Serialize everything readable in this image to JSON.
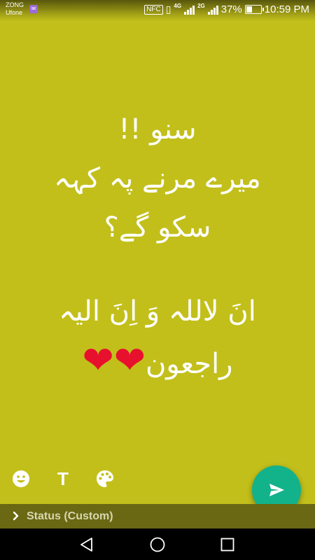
{
  "status_bar": {
    "carrier_1": "ZONG",
    "carrier_2": "Ufone",
    "nfc_label": "NFC",
    "network_1": "4G",
    "network_2": "2G",
    "battery_percent_text": "37%",
    "battery_level": 0.37,
    "time": "10:59 PM"
  },
  "status": {
    "line_1": "سنو !!",
    "line_2": "میرے مرنے پہ کہہ",
    "line_3": "سکو گے؟",
    "line_4": "انَ لاللہ وَ اِنَ الیہ",
    "line_5": "راجعون",
    "hearts": "❤❤"
  },
  "toolbar": {
    "emoji_icon": "emoji-icon",
    "text_icon_label": "T",
    "palette_icon": "palette-icon"
  },
  "audience": {
    "label": "Status (Custom)"
  },
  "colors": {
    "background": "#c2bf1b",
    "fab": "#12b28b",
    "audience_bar": "#6a6813",
    "heart": "#e8112d"
  }
}
